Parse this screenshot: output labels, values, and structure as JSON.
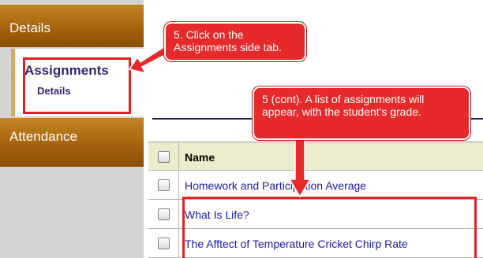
{
  "sidebar": {
    "tabs": [
      {
        "label": "Details"
      },
      {
        "label": "Assignments",
        "sub_label": "Details"
      },
      {
        "label": "Attendance"
      }
    ]
  },
  "callouts": [
    {
      "text": "5.  Click on the Assignments side tab."
    },
    {
      "text": "5  (cont). A list of assignments will appear, with the student's grade."
    }
  ],
  "table": {
    "header": "Name",
    "rows": [
      {
        "name": "Homework and Participation Average"
      },
      {
        "name": "What Is Life?"
      },
      {
        "name": "The Afftect of Temperature Cricket Chirp Rate"
      }
    ]
  },
  "colors": {
    "tab_brown": "#a35f0b",
    "callout_red": "#e6292a",
    "header_bg": "#ececcc",
    "link_blue": "#1a1aa6",
    "active_text": "#382470"
  }
}
